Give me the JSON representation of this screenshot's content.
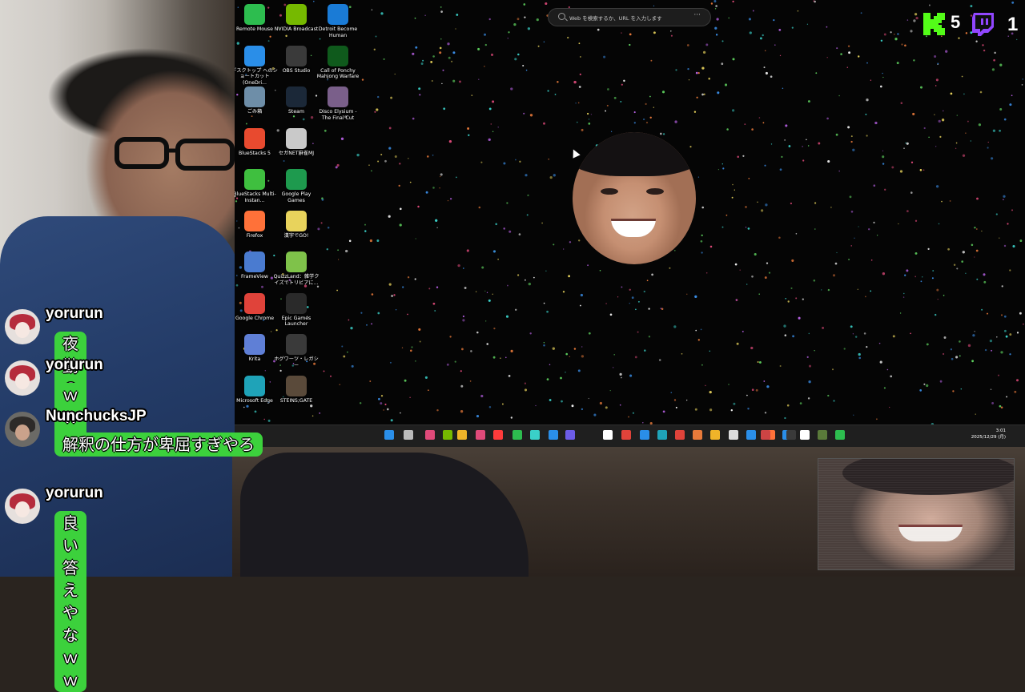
{
  "desktop": {
    "search": {
      "placeholder": "Web を検索するか、URL を入力します",
      "more": "···"
    },
    "icons": [
      {
        "label": "Remote Mouse",
        "icon": "remote-mouse-icon",
        "color": "#2dbd4f"
      },
      {
        "label": "NVIDIA Broadcast",
        "icon": "nvidia-icon",
        "color": "#76b900"
      },
      {
        "label": "Detroit Become Human",
        "icon": "detroit-icon",
        "color": "#1a7bd6"
      },
      {
        "label": "デスクトップ へのショートカット (OneDri...",
        "icon": "onedrive-icon",
        "color": "#2a8ee8"
      },
      {
        "label": "OBS Studio",
        "icon": "obs-icon",
        "color": "#3a3a3a"
      },
      {
        "label": "Call of Ponchy Mahjong Warfare",
        "icon": "mahjong-icon",
        "color": "#0f5a1c"
      },
      {
        "label": "ごみ箱",
        "icon": "recycle-bin-icon",
        "color": "#6e8ea8"
      },
      {
        "label": "Steam",
        "icon": "steam-icon",
        "color": "#1b2838"
      },
      {
        "label": "Disco Elysium - The Final Cut",
        "icon": "disco-elysium-icon",
        "color": "#7a5f8a"
      },
      {
        "label": "BlueStacks 5",
        "icon": "bluestacks-icon",
        "color": "#e84a2f"
      },
      {
        "label": "セガNET麻雀MJ",
        "icon": "sega-mj-icon",
        "color": "#c9c9c9"
      },
      {
        "label": "",
        "icon": "blank-icon",
        "color": "transparent"
      },
      {
        "label": "BlueStacks Multi-Instan...",
        "icon": "bluestacks-multi-icon",
        "color": "#3fbf3f"
      },
      {
        "label": "Google Play Games",
        "icon": "google-play-games-icon",
        "color": "#1e9a4e"
      },
      {
        "label": "",
        "icon": "blank-icon",
        "color": "transparent"
      },
      {
        "label": "Firefox",
        "icon": "firefox-icon",
        "color": "#ff7139"
      },
      {
        "label": "漢字でGO!",
        "icon": "kanji-go-icon",
        "color": "#e8d35c"
      },
      {
        "label": "",
        "icon": "blank-icon",
        "color": "transparent"
      },
      {
        "label": "FrameView",
        "icon": "frameview-icon",
        "color": "#4a7bd0"
      },
      {
        "label": "QuizzLand：雑学クイズでトリビアに...",
        "icon": "quizzland-icon",
        "color": "#7fc24a"
      },
      {
        "label": "",
        "icon": "blank-icon",
        "color": "transparent"
      },
      {
        "label": "Google Chrome",
        "icon": "chrome-icon",
        "color": "#e0433a"
      },
      {
        "label": "Epic Games Launcher",
        "icon": "epic-games-icon",
        "color": "#2a2a2a"
      },
      {
        "label": "",
        "icon": "blank-icon",
        "color": "transparent"
      },
      {
        "label": "Krita",
        "icon": "krita-icon",
        "color": "#5f7fd6"
      },
      {
        "label": "ホグワーツ・レガシー",
        "icon": "hogwarts-legacy-icon",
        "color": "#3a3a3a"
      },
      {
        "label": "",
        "icon": "blank-icon",
        "color": "transparent"
      },
      {
        "label": "Microsoft Edge",
        "icon": "edge-icon",
        "color": "#1fa3b8"
      },
      {
        "label": "STEINS;GATE",
        "icon": "steins-gate-icon",
        "color": "#5a4a3a"
      }
    ],
    "taskbar": {
      "time": "3:01",
      "date": "2025/12/29 (月)"
    }
  },
  "overlay": {
    "kick_count": "5",
    "twitch_count": "1",
    "kick_color": "#53fc18",
    "twitch_color": "#9146ff"
  },
  "chat": [
    {
      "user": "yorurun",
      "message": "夜勤のね"
    },
    {
      "user": "yorurun",
      "message": "ｗｗｗ"
    },
    {
      "user": "NunchucksJP",
      "message": "解釈の仕方が卑屈すぎやろ"
    },
    {
      "user": "yorurun",
      "message": "良い答えやなｗｗ"
    }
  ]
}
